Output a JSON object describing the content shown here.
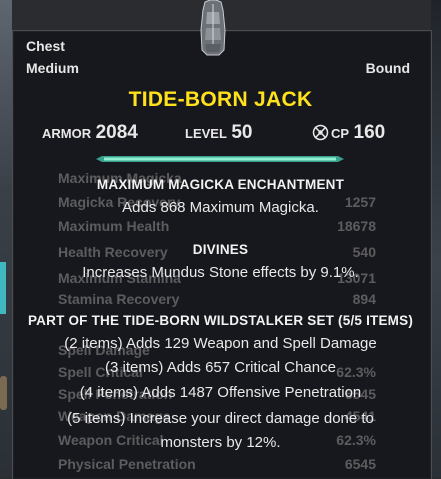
{
  "item": {
    "slot_type": "Chest",
    "weight": "Medium",
    "bind_status": "Bound",
    "name": "TIDE-BORN JACK",
    "armor_label": "ARMOR",
    "armor_value": "2084",
    "level_label": "LEVEL",
    "level_value": "50",
    "cp_label": "CP",
    "cp_value": "160"
  },
  "enchantment": {
    "title": "MAXIMUM MAGICKA ENCHANTMENT",
    "description": "Adds 868 Maximum Magicka."
  },
  "trait": {
    "title": "DIVINES",
    "description": "Increases Mundus Stone effects by 9.1%."
  },
  "set": {
    "title": "PART OF THE TIDE-BORN WILDSTALKER SET (5/5 ITEMS)",
    "bonuses": [
      "(2 items) Adds 129 Weapon and Spell Damage",
      "(3 items) Adds 657 Critical Chance",
      "(4 items) Adds 1487 Offensive Penetration",
      "(5 items) Increase your direct damage done to",
      "monsters by 12%."
    ]
  },
  "background_stats": [
    {
      "name": "Maximum Magicka",
      "value": ""
    },
    {
      "name": "Magicka Recovery",
      "value": "1257"
    },
    {
      "name": "Maximum Health",
      "value": "18678"
    },
    {
      "name": "Health Recovery",
      "value": "540"
    },
    {
      "name": "Maximum Stamina",
      "value": "13071"
    },
    {
      "name": "Stamina Recovery",
      "value": "894"
    },
    {
      "name": "Spell Damage",
      "value": ""
    },
    {
      "name": "Spell Critical",
      "value": "62.3%"
    },
    {
      "name": "Spell Penetration",
      "value": "6545"
    },
    {
      "name": "Weapon Damage",
      "value": "4541"
    },
    {
      "name": "Weapon Critical",
      "value": "62.3%"
    },
    {
      "name": "Physical Penetration",
      "value": "6545"
    }
  ],
  "colors": {
    "item_name": "#ffe21c",
    "text": "#e9e9e9",
    "divider_glow": "#7de3c6"
  },
  "icons": [
    "chest-armor-icon",
    "champion-points-icon"
  ]
}
